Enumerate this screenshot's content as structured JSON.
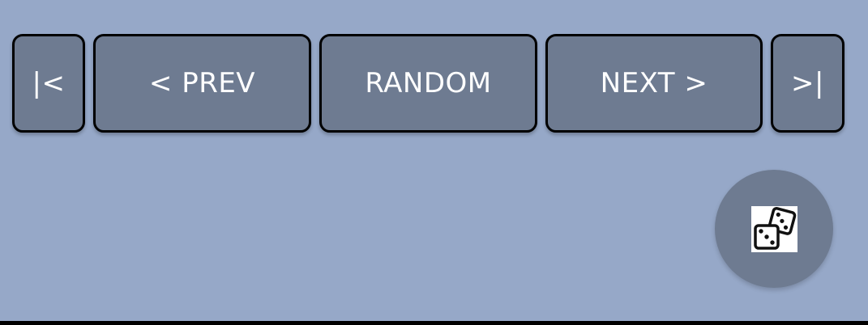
{
  "nav": {
    "first_label": "|<",
    "prev_label": "< PREV",
    "random_label": "RANDOM",
    "next_label": "NEXT >",
    "last_label": ">|"
  },
  "fab": {
    "icon": "dice-icon"
  },
  "colors": {
    "background": "#96a8c8",
    "button_fill": "#6e7b91",
    "button_border": "#000000",
    "button_text": "#ffffff"
  }
}
